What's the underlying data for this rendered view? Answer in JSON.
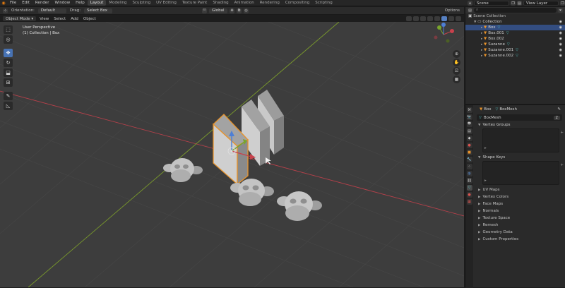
{
  "topbar": {
    "menus": [
      "File",
      "Edit",
      "Render",
      "Window",
      "Help"
    ],
    "workspaces": [
      "Layout",
      "Modeling",
      "Sculpting",
      "UV Editing",
      "Texture Paint",
      "Shading",
      "Animation",
      "Rendering",
      "Compositing",
      "Scripting"
    ],
    "active_workspace": "Layout",
    "scene_label": "Scene",
    "view_layer_label": "View Layer"
  },
  "tool_header": {
    "orientation_label": "Orientation:",
    "orientation_value": "Default",
    "drag_label": "Drag:",
    "drag_value": "Select Box",
    "transform_orientation": "Global",
    "options_label": "Options"
  },
  "viewport_header": {
    "mode": "Object Mode",
    "menus": [
      "View",
      "Select",
      "Add",
      "Object"
    ]
  },
  "viewport": {
    "perspective_label": "User Perspective",
    "collection_label": "(1) Collection | Box"
  },
  "toolbar": {
    "tools": [
      "select-icon",
      "cursor-icon",
      "move-icon",
      "rotate-icon",
      "scale-icon",
      "transform-icon",
      "annotate-icon",
      "measure-icon"
    ],
    "active_tool": "move-icon"
  },
  "outliner": {
    "search_placeholder": "",
    "root": "Scene Collection",
    "collection": "Collection",
    "items": [
      {
        "name": "Box",
        "selected": true
      },
      {
        "name": "Box.001",
        "selected": false
      },
      {
        "name": "Box.002",
        "selected": false
      },
      {
        "name": "Suzanne",
        "selected": false
      },
      {
        "name": "Suzanne.001",
        "selected": false
      },
      {
        "name": "Suzanne.002",
        "selected": false
      }
    ]
  },
  "properties": {
    "crumb_object": "Box",
    "crumb_data": "BoxMesh",
    "data_name": "BoxMesh",
    "data_users": "2",
    "panels_open": [
      "Vertex Groups",
      "Shape Keys"
    ],
    "panels_closed": [
      "UV Maps",
      "Vertex Colors",
      "Face Maps",
      "Normals",
      "Texture Space",
      "Remesh",
      "Geometry Data",
      "Custom Properties"
    ]
  },
  "colors": {
    "accent": "#4772b3",
    "selection_orange": "#e8932b",
    "x_axis": "#b5404a",
    "y_axis": "#7a9a2c"
  }
}
